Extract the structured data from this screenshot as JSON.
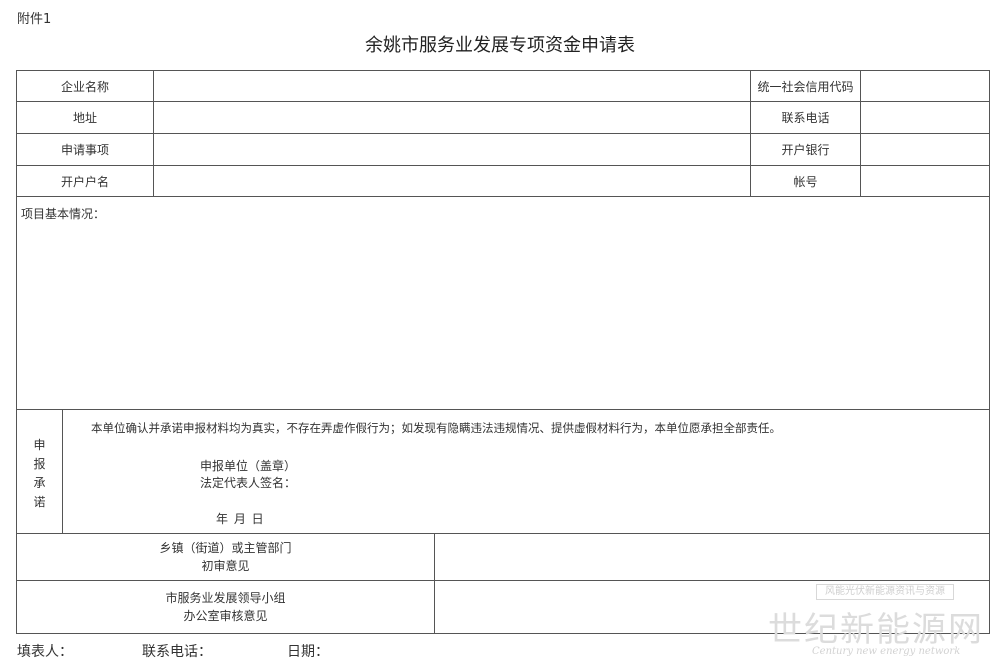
{
  "attachment_label": "附件1",
  "title": "余姚市服务业发展专项资金申请表",
  "rows": [
    {
      "left_label": "企业名称",
      "right_label": "统一社会信用代码"
    },
    {
      "left_label": "地址",
      "right_label": "联系电话"
    },
    {
      "left_label": "申请事项",
      "right_label": "开户银行"
    },
    {
      "left_label": "开户户名",
      "right_label": "帐号"
    }
  ],
  "project_label": "项目基本情况：",
  "pledge": {
    "side_chars": [
      "申",
      "报",
      "承",
      "诺"
    ],
    "statement": "本单位确认并承诺申报材料均为真实，不存在弄虚作假行为；如发现有隐瞒违法违规情况、提供虚假材料行为，本单位愿承担全部责任。",
    "applicant_unit": "申报单位（盖章）",
    "legal_rep": "法定代表人签名：",
    "date": "年 月 日"
  },
  "review": [
    {
      "line1": "乡镇（街道）或主管部门",
      "line2": "初审意见"
    },
    {
      "line1": "市服务业发展领导小组",
      "line2": "办公室审核意见"
    }
  ],
  "footer": {
    "filler": "填表人：",
    "phone": "联系电话：",
    "date": "日期："
  },
  "watermark": {
    "box_text": "风能光伏新能源资讯与资源",
    "main": "世纪新能源网",
    "sub": "Century new energy network"
  }
}
